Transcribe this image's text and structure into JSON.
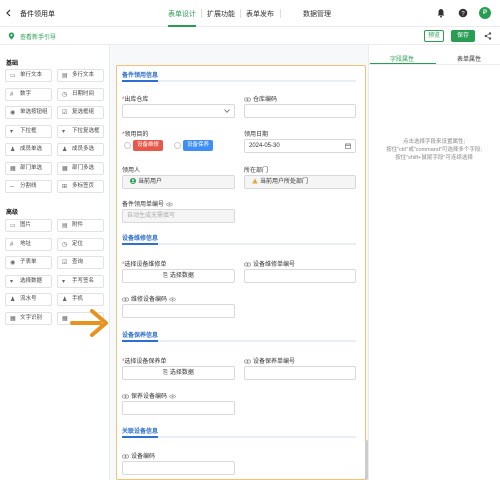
{
  "header": {
    "app_title": "备件领用单",
    "tabs": [
      "表单设计",
      "扩展功能",
      "表单发布",
      "数据管理"
    ],
    "avatar_letter": "P"
  },
  "subbar": {
    "guide_label": "查看新手引导",
    "preview_label": "预览",
    "save_label": "保存"
  },
  "left_panel": {
    "basic_title": "基础",
    "basic_items": [
      "单行文本",
      "多行文本",
      "数字",
      "日期时间",
      "单选按钮组",
      "复选框组",
      "下拉框",
      "下拉复选框",
      "成员单选",
      "成员多选",
      "部门单选",
      "部门多选",
      "分割线",
      "多标签页"
    ],
    "advanced_title": "高级",
    "advanced_items": [
      "图片",
      "附件",
      "地址",
      "定位",
      "子表单",
      "查询",
      "选择数据",
      "手写签名",
      "流水号",
      "手机",
      "文字识别",
      ""
    ]
  },
  "form": {
    "groups": {
      "g1": "备件领用信息",
      "g2": "设备维修信息",
      "g3": "设备保养信息",
      "g4": "关联设备信息"
    },
    "fields": {
      "warehouse_out": "出库仓库",
      "warehouse_code": "仓库编码",
      "purpose": "领用目的",
      "purpose_opt1": "设备维修",
      "purpose_opt2": "设备保养",
      "date_label": "领用日期",
      "date_value": "2024-05-30",
      "person_label": "领用人",
      "person_value": "当前用户",
      "dept_label": "所在部门",
      "dept_value": "当前用户所处部门",
      "form_no_label": "备件领用单编号",
      "form_no_placeholder": "自动生成无需填写",
      "repair_select_label": "选择设备维修单",
      "repair_select_btn": "选择数据",
      "repair_no_label": "设备维修单编号",
      "repair_code_label": "维修设备编码",
      "maint_select_label": "选择设备保养单",
      "maint_select_btn": "选择数据",
      "maint_no_label": "设备保养单编号",
      "maint_code_label": "保养设备编码",
      "device_code_label": "设备编码"
    }
  },
  "right_panel": {
    "tabs": [
      "字段属性",
      "表单属性"
    ],
    "hint_lines": [
      "点击选择字段来设置属性;",
      "按住\"ctrl\"或\"command\"可选择多个字段;",
      "按住\"shift+鼠尾字段\"可连续选择"
    ]
  },
  "colors": {
    "accent": "#2a9d55",
    "group_title": "#2f6fd1",
    "chip_red": "#e8584a",
    "chip_blue": "#3e8ef7",
    "arrow": "#e8921f"
  }
}
